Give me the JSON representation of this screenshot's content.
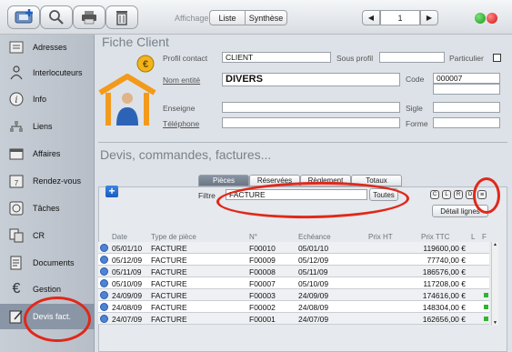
{
  "toolbar": {
    "affichage_label": "Affichage",
    "liste_label": "Liste",
    "synthese_label": "Synthèse",
    "page_number": "1"
  },
  "sidebar": {
    "items": [
      {
        "label": "Adresses",
        "icon": "address-card-icon"
      },
      {
        "label": "Interlocuteurs",
        "icon": "person-icon"
      },
      {
        "label": "Info",
        "icon": "info-icon"
      },
      {
        "label": "Liens",
        "icon": "links-icon"
      },
      {
        "label": "Affaires",
        "icon": "folder-icon"
      },
      {
        "label": "Rendez-vous",
        "icon": "calendar-icon"
      },
      {
        "label": "Tâches",
        "icon": "task-icon"
      },
      {
        "label": "CR",
        "icon": "report-icon"
      },
      {
        "label": "Documents",
        "icon": "document-icon"
      },
      {
        "label": "Gestion",
        "icon": "euro-icon"
      },
      {
        "label": "Devis fact.",
        "icon": "invoice-icon"
      }
    ]
  },
  "fiche": {
    "title": "Fiche  Client",
    "profil_contact_label": "Profil contact",
    "profil_contact_value": "CLIENT",
    "sous_profil_label": "Sous profil",
    "sous_profil_value": "",
    "particulier_label": "Particulier",
    "nom_entite_label": "Nom entité",
    "nom_entite_value": "DIVERS",
    "code_label": "Code",
    "code_value": "000007",
    "enseigne_label": "Enseigne",
    "sigle_label": "Sigle",
    "telephone_label": "Téléphone",
    "forme_label": "Forme"
  },
  "devis": {
    "title": "Devis, commandes, factures...",
    "tabs": [
      "Pièces",
      "Réservées",
      "Règlement",
      "Totaux"
    ],
    "filtre_label": "Filtre",
    "filtre_value": "FACTURE",
    "toutes_label": "Toutes",
    "mini_buttons": [
      "C",
      "L",
      "R",
      "D"
    ],
    "detail_label": "Détail lignes",
    "columns": [
      "Date",
      "Type de pièce",
      "N°",
      "Echéance",
      "Prix HT",
      "Prix TTC",
      "L",
      "F"
    ],
    "rows": [
      {
        "date": "05/01/10",
        "type": "FACTURE",
        "num": "F00010",
        "echeance": "05/01/10",
        "prix_ht": "",
        "prix_ttc": "119600,00 €",
        "f": false
      },
      {
        "date": "05/12/09",
        "type": "FACTURE",
        "num": "F00009",
        "echeance": "05/12/09",
        "prix_ht": "",
        "prix_ttc": "77740,00 €",
        "f": false
      },
      {
        "date": "05/11/09",
        "type": "FACTURE",
        "num": "F00008",
        "echeance": "05/11/09",
        "prix_ht": "",
        "prix_ttc": "186576,00 €",
        "f": false
      },
      {
        "date": "05/10/09",
        "type": "FACTURE",
        "num": "F00007",
        "echeance": "05/10/09",
        "prix_ht": "",
        "prix_ttc": "117208,00 €",
        "f": false
      },
      {
        "date": "24/09/09",
        "type": "FACTURE",
        "num": "F00003",
        "echeance": "24/09/09",
        "prix_ht": "",
        "prix_ttc": "174616,00 €",
        "f": true
      },
      {
        "date": "24/08/09",
        "type": "FACTURE",
        "num": "F00002",
        "echeance": "24/08/09",
        "prix_ht": "",
        "prix_ttc": "148304,00 €",
        "f": true
      },
      {
        "date": "24/07/09",
        "type": "FACTURE",
        "num": "F00001",
        "echeance": "24/07/09",
        "prix_ht": "",
        "prix_ttc": "162656,00 €",
        "f": true
      }
    ]
  },
  "colors": {
    "accent": "#2f6fd0",
    "highlight_ring": "#e0281a",
    "house": "#f39a1c"
  }
}
